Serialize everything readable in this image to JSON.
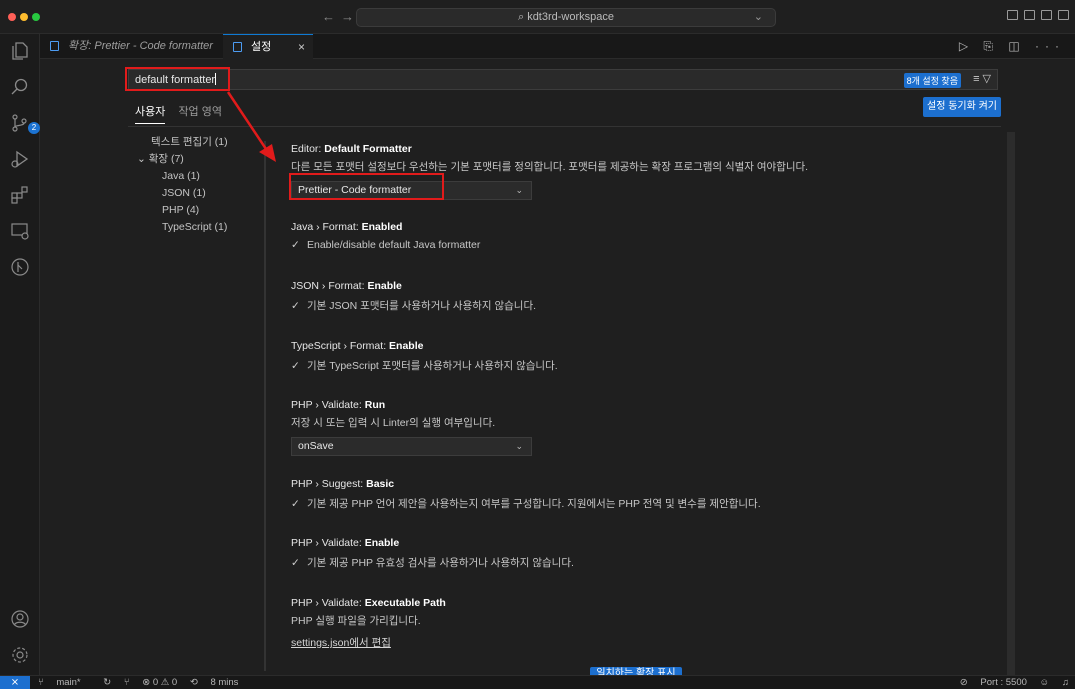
{
  "window": {
    "command_center": "kdt3rd-workspace"
  },
  "tabs": [
    {
      "label": "확장: Prettier - Code formatter"
    },
    {
      "label": "설정",
      "close": "×"
    }
  ],
  "search": {
    "value": "default formatter",
    "result_count": "8개 설정 찾음"
  },
  "scope": {
    "user": "사용자",
    "workspace": "작업 영역",
    "sync_button": "설정 동기화 켜기"
  },
  "toc": [
    "텍스트 편집기 (1)",
    "확장 (7)",
    "Java (1)",
    "JSON (1)",
    "PHP (4)",
    "TypeScript (1)"
  ],
  "settings": {
    "default_formatter": {
      "prefix": "Editor: ",
      "name": "Default Formatter",
      "desc": "다른 모든 포맷터 설정보다 우선하는 기본 포맷터를 정의합니다. 포맷터를 제공하는 확장 프로그램의 식별자 여야합니다.",
      "value": "Prettier - Code formatter"
    },
    "java_format": {
      "prefix": "Java › Format: ",
      "name": "Enabled",
      "check": "Enable/disable default Java formatter"
    },
    "json_format": {
      "prefix": "JSON › Format: ",
      "name": "Enable",
      "check": "기본 JSON 포맷터를 사용하거나 사용하지 않습니다."
    },
    "ts_format": {
      "prefix": "TypeScript › Format: ",
      "name": "Enable",
      "check": "기본 TypeScript 포맷터를 사용하거나 사용하지 않습니다."
    },
    "php_validate_run": {
      "prefix": "PHP › Validate: ",
      "name": "Run",
      "desc": "저장 시 또는 입력 시 Linter의 실행 여부입니다.",
      "value": "onSave"
    },
    "php_suggest": {
      "prefix": "PHP › Suggest: ",
      "name": "Basic",
      "check": "기본 제공 PHP 언어 제안을 사용하는지 여부를 구성합니다. 지원에서는 PHP 전역 및 변수를 제안합니다."
    },
    "php_validate_enable": {
      "prefix": "PHP › Validate: ",
      "name": "Enable",
      "check": "기본 제공 PHP 유효성 검사를 사용하거나 사용하지 않습니다."
    },
    "php_exec_path": {
      "prefix": "PHP › Validate: ",
      "name": "Executable Path",
      "desc": "PHP 실행 파일을 가리킵니다.",
      "link": "settings.json에서 편집"
    }
  },
  "show_more_button": "일치하는 확장 표시",
  "statusbar": {
    "branch": "main*",
    "problems": "⊗ 0 ⚠ 0",
    "time": "8 mins",
    "port": "Port : 5500"
  },
  "colors": {
    "accent": "#1c6fcf",
    "annotation_red": "#e11b1b"
  }
}
